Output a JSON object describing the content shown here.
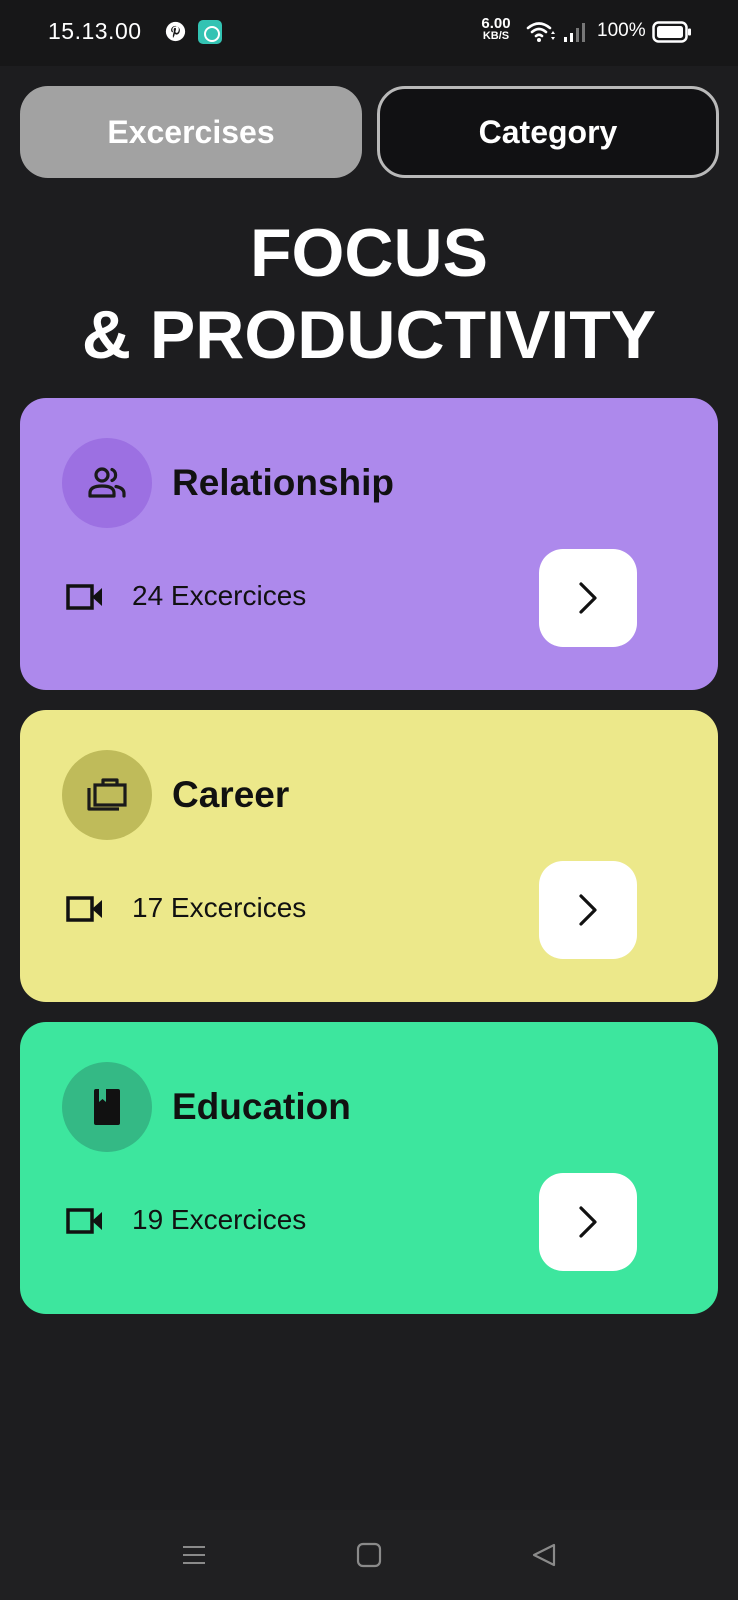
{
  "status_bar": {
    "time": "15.13.00",
    "net_speed_value": "6.00",
    "net_speed_unit": "KB/S",
    "battery": "100%"
  },
  "tabs": [
    {
      "label": "Excercises",
      "active": true
    },
    {
      "label": "Category",
      "active": false
    }
  ],
  "heading": {
    "line1": "FOCUS",
    "line2": "& PRODUCTIVITY"
  },
  "categories": [
    {
      "title": "Relationship",
      "count_label": "24 Excercices",
      "icon": "people-icon",
      "color": "#ad89ec",
      "icon_bg": "#9c70e2"
    },
    {
      "title": "Career",
      "count_label": "17 Excercices",
      "icon": "briefcase-icon",
      "color": "#ece88a",
      "icon_bg": "#bfbb5a"
    },
    {
      "title": "Education",
      "count_label": "19 Excercices",
      "icon": "book-icon",
      "color": "#3de69e",
      "icon_bg": "#34b985"
    }
  ],
  "nav": {
    "items": [
      "menu-icon",
      "home-square-icon",
      "back-triangle-icon"
    ]
  },
  "colors": {
    "background": "#1d1d1f",
    "tab_active": "#a2a2a2",
    "tab_inactive_border": "#b9b9b9"
  }
}
